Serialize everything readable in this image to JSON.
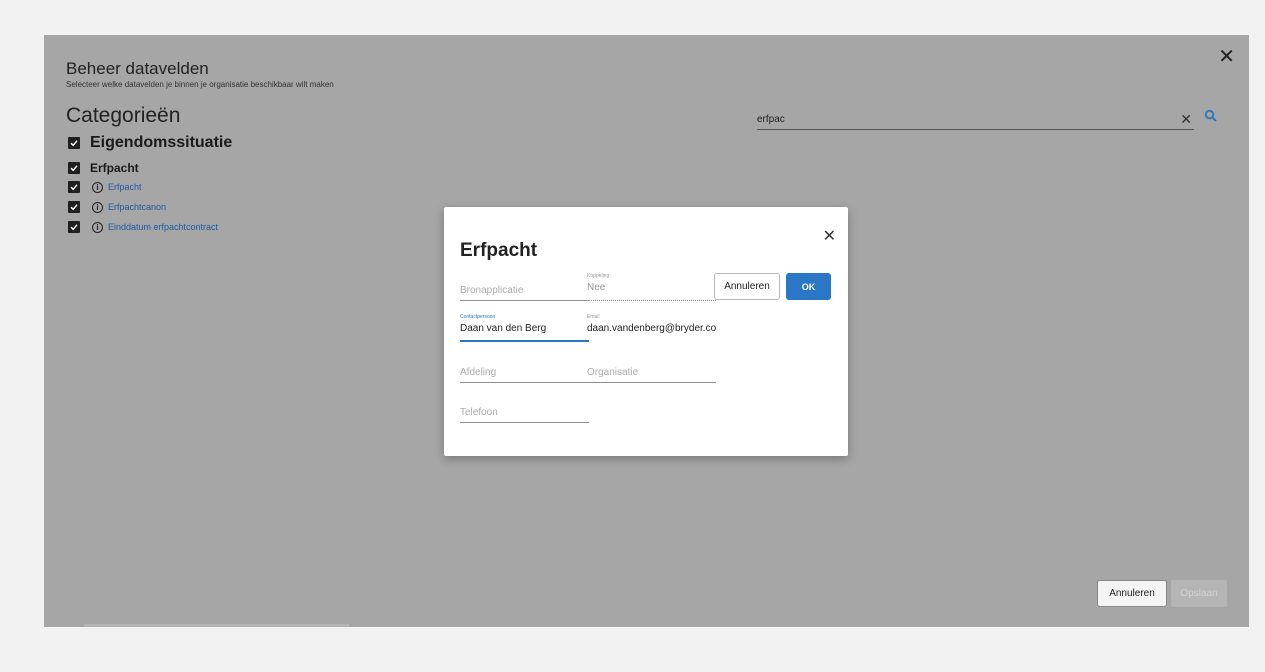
{
  "page": {
    "title": "Beheer datavelden",
    "subtitle": "Selecteer welke datavelden je binnen je organisatie beschikbaar wilt maken",
    "categories_title": "Categorieën",
    "close_icon": "close-icon"
  },
  "tree": {
    "group": "Eigendomssituatie",
    "subgroup": "Erfpacht",
    "items": [
      "Erfpacht",
      "Erfpachtcanon",
      "Einddatum erfpachtcontract"
    ]
  },
  "search": {
    "value": "erfpac",
    "clear_icon": "clear-icon",
    "icon": "search-icon"
  },
  "footer": {
    "cancel_label": "Annuleren",
    "save_label": "Opslaan"
  },
  "dialog": {
    "title": "Erfpacht",
    "fields": {
      "bronapplicatie": {
        "placeholder": "Bronapplicatie"
      },
      "koppeling": {
        "label": "Koppeling",
        "value": "Nee"
      },
      "contactpersoon": {
        "label": "Contactpersoon",
        "value": "Daan van den Berg"
      },
      "email": {
        "label": "Email",
        "value": "daan.vandenberg@bryder.com"
      },
      "afdeling": {
        "placeholder": "Afdeling"
      },
      "organisatie": {
        "placeholder": "Organisatie"
      },
      "telefoon": {
        "placeholder": "Telefoon"
      }
    },
    "cancel_label": "Annuleren",
    "ok_label": "OK"
  },
  "colors": {
    "accent": "#2a78c5",
    "link": "#1e5aa0",
    "overlay": "#a6a6a6"
  }
}
